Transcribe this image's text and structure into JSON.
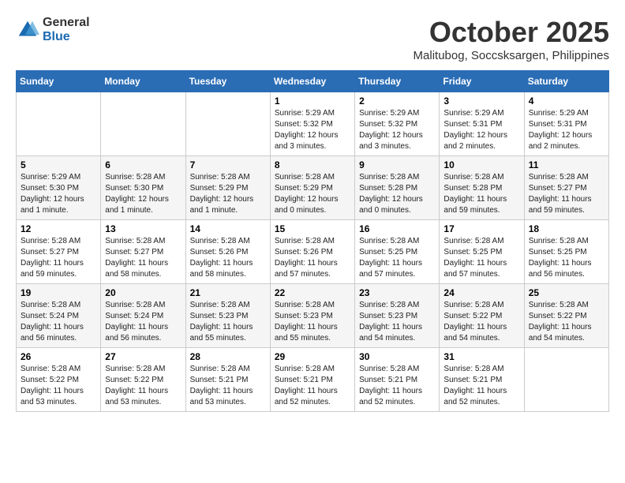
{
  "header": {
    "logo_general": "General",
    "logo_blue": "Blue",
    "month_title": "October 2025",
    "location": "Malitubog, Soccsksargen, Philippines"
  },
  "weekdays": [
    "Sunday",
    "Monday",
    "Tuesday",
    "Wednesday",
    "Thursday",
    "Friday",
    "Saturday"
  ],
  "weeks": [
    [
      {
        "day": "",
        "info": ""
      },
      {
        "day": "",
        "info": ""
      },
      {
        "day": "",
        "info": ""
      },
      {
        "day": "1",
        "info": "Sunrise: 5:29 AM\nSunset: 5:32 PM\nDaylight: 12 hours and 3 minutes."
      },
      {
        "day": "2",
        "info": "Sunrise: 5:29 AM\nSunset: 5:32 PM\nDaylight: 12 hours and 3 minutes."
      },
      {
        "day": "3",
        "info": "Sunrise: 5:29 AM\nSunset: 5:31 PM\nDaylight: 12 hours and 2 minutes."
      },
      {
        "day": "4",
        "info": "Sunrise: 5:29 AM\nSunset: 5:31 PM\nDaylight: 12 hours and 2 minutes."
      }
    ],
    [
      {
        "day": "5",
        "info": "Sunrise: 5:29 AM\nSunset: 5:30 PM\nDaylight: 12 hours and 1 minute."
      },
      {
        "day": "6",
        "info": "Sunrise: 5:28 AM\nSunset: 5:30 PM\nDaylight: 12 hours and 1 minute."
      },
      {
        "day": "7",
        "info": "Sunrise: 5:28 AM\nSunset: 5:29 PM\nDaylight: 12 hours and 1 minute."
      },
      {
        "day": "8",
        "info": "Sunrise: 5:28 AM\nSunset: 5:29 PM\nDaylight: 12 hours and 0 minutes."
      },
      {
        "day": "9",
        "info": "Sunrise: 5:28 AM\nSunset: 5:28 PM\nDaylight: 12 hours and 0 minutes."
      },
      {
        "day": "10",
        "info": "Sunrise: 5:28 AM\nSunset: 5:28 PM\nDaylight: 11 hours and 59 minutes."
      },
      {
        "day": "11",
        "info": "Sunrise: 5:28 AM\nSunset: 5:27 PM\nDaylight: 11 hours and 59 minutes."
      }
    ],
    [
      {
        "day": "12",
        "info": "Sunrise: 5:28 AM\nSunset: 5:27 PM\nDaylight: 11 hours and 59 minutes."
      },
      {
        "day": "13",
        "info": "Sunrise: 5:28 AM\nSunset: 5:27 PM\nDaylight: 11 hours and 58 minutes."
      },
      {
        "day": "14",
        "info": "Sunrise: 5:28 AM\nSunset: 5:26 PM\nDaylight: 11 hours and 58 minutes."
      },
      {
        "day": "15",
        "info": "Sunrise: 5:28 AM\nSunset: 5:26 PM\nDaylight: 11 hours and 57 minutes."
      },
      {
        "day": "16",
        "info": "Sunrise: 5:28 AM\nSunset: 5:25 PM\nDaylight: 11 hours and 57 minutes."
      },
      {
        "day": "17",
        "info": "Sunrise: 5:28 AM\nSunset: 5:25 PM\nDaylight: 11 hours and 57 minutes."
      },
      {
        "day": "18",
        "info": "Sunrise: 5:28 AM\nSunset: 5:25 PM\nDaylight: 11 hours and 56 minutes."
      }
    ],
    [
      {
        "day": "19",
        "info": "Sunrise: 5:28 AM\nSunset: 5:24 PM\nDaylight: 11 hours and 56 minutes."
      },
      {
        "day": "20",
        "info": "Sunrise: 5:28 AM\nSunset: 5:24 PM\nDaylight: 11 hours and 56 minutes."
      },
      {
        "day": "21",
        "info": "Sunrise: 5:28 AM\nSunset: 5:23 PM\nDaylight: 11 hours and 55 minutes."
      },
      {
        "day": "22",
        "info": "Sunrise: 5:28 AM\nSunset: 5:23 PM\nDaylight: 11 hours and 55 minutes."
      },
      {
        "day": "23",
        "info": "Sunrise: 5:28 AM\nSunset: 5:23 PM\nDaylight: 11 hours and 54 minutes."
      },
      {
        "day": "24",
        "info": "Sunrise: 5:28 AM\nSunset: 5:22 PM\nDaylight: 11 hours and 54 minutes."
      },
      {
        "day": "25",
        "info": "Sunrise: 5:28 AM\nSunset: 5:22 PM\nDaylight: 11 hours and 54 minutes."
      }
    ],
    [
      {
        "day": "26",
        "info": "Sunrise: 5:28 AM\nSunset: 5:22 PM\nDaylight: 11 hours and 53 minutes."
      },
      {
        "day": "27",
        "info": "Sunrise: 5:28 AM\nSunset: 5:22 PM\nDaylight: 11 hours and 53 minutes."
      },
      {
        "day": "28",
        "info": "Sunrise: 5:28 AM\nSunset: 5:21 PM\nDaylight: 11 hours and 53 minutes."
      },
      {
        "day": "29",
        "info": "Sunrise: 5:28 AM\nSunset: 5:21 PM\nDaylight: 11 hours and 52 minutes."
      },
      {
        "day": "30",
        "info": "Sunrise: 5:28 AM\nSunset: 5:21 PM\nDaylight: 11 hours and 52 minutes."
      },
      {
        "day": "31",
        "info": "Sunrise: 5:28 AM\nSunset: 5:21 PM\nDaylight: 11 hours and 52 minutes."
      },
      {
        "day": "",
        "info": ""
      }
    ]
  ]
}
